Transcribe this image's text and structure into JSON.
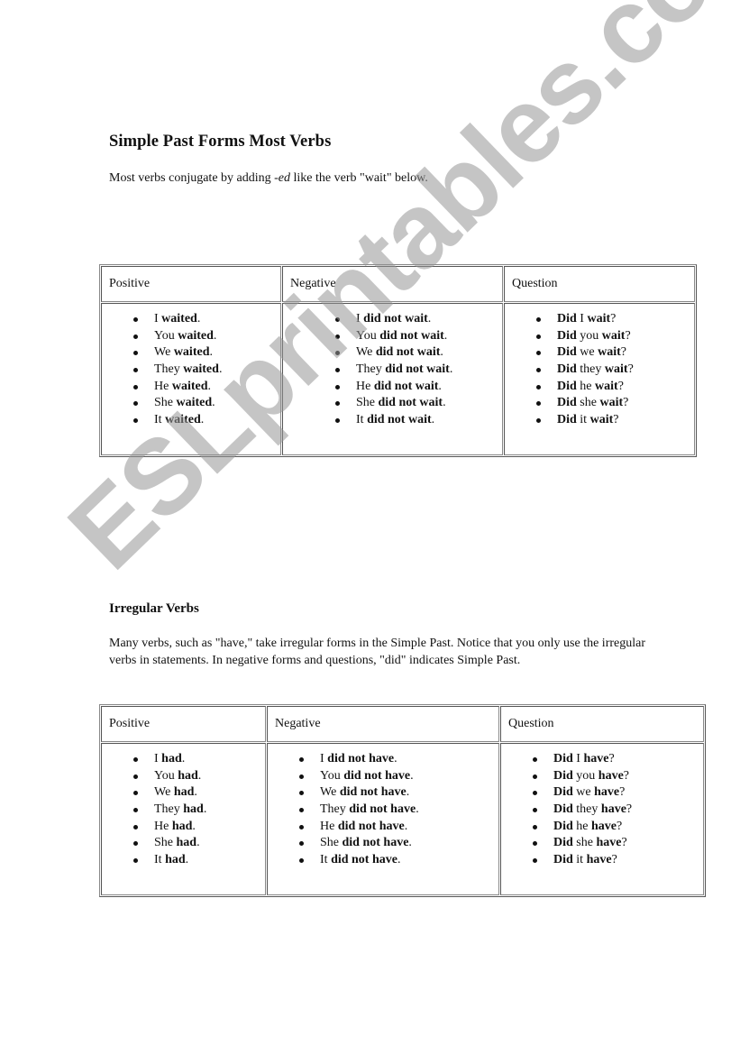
{
  "section1": {
    "title": "Simple Past Forms Most Verbs",
    "intro": {
      "before": "Most verbs conjugate by adding ",
      "italic": "-ed",
      "after": " like the verb \"wait\" below."
    },
    "table": {
      "headers": [
        "Positive",
        "Negative",
        "Question"
      ],
      "columns": [
        [
          [
            {
              "t": "I ",
              "b": false
            },
            {
              "t": "waited",
              "b": true
            },
            {
              "t": ".",
              "b": false
            }
          ],
          [
            {
              "t": "You ",
              "b": false
            },
            {
              "t": "waited",
              "b": true
            },
            {
              "t": ".",
              "b": false
            }
          ],
          [
            {
              "t": "We ",
              "b": false
            },
            {
              "t": "waited",
              "b": true
            },
            {
              "t": ".",
              "b": false
            }
          ],
          [
            {
              "t": "They ",
              "b": false
            },
            {
              "t": "waited",
              "b": true
            },
            {
              "t": ".",
              "b": false
            }
          ],
          [
            {
              "t": "He ",
              "b": false
            },
            {
              "t": "waited",
              "b": true
            },
            {
              "t": ".",
              "b": false
            }
          ],
          [
            {
              "t": "She ",
              "b": false
            },
            {
              "t": "waited",
              "b": true
            },
            {
              "t": ".",
              "b": false
            }
          ],
          [
            {
              "t": "It ",
              "b": false
            },
            {
              "t": "waited",
              "b": true
            },
            {
              "t": ".",
              "b": false
            }
          ]
        ],
        [
          [
            {
              "t": "I ",
              "b": false
            },
            {
              "t": "did not wait",
              "b": true
            },
            {
              "t": ".",
              "b": false
            }
          ],
          [
            {
              "t": "You ",
              "b": false
            },
            {
              "t": "did not wait",
              "b": true
            },
            {
              "t": ".",
              "b": false
            }
          ],
          [
            {
              "t": "We ",
              "b": false
            },
            {
              "t": "did not wait",
              "b": true
            },
            {
              "t": ".",
              "b": false
            }
          ],
          [
            {
              "t": "They ",
              "b": false
            },
            {
              "t": "did not wait",
              "b": true
            },
            {
              "t": ".",
              "b": false
            }
          ],
          [
            {
              "t": "He ",
              "b": false
            },
            {
              "t": "did not wait",
              "b": true
            },
            {
              "t": ".",
              "b": false
            }
          ],
          [
            {
              "t": "She ",
              "b": false
            },
            {
              "t": "did not wait",
              "b": true
            },
            {
              "t": ".",
              "b": false
            }
          ],
          [
            {
              "t": "It ",
              "b": false
            },
            {
              "t": "did not wait",
              "b": true
            },
            {
              "t": ".",
              "b": false
            }
          ]
        ],
        [
          [
            {
              "t": "Did ",
              "b": true
            },
            {
              "t": "I ",
              "b": false
            },
            {
              "t": "wait",
              "b": true
            },
            {
              "t": "?",
              "b": false
            }
          ],
          [
            {
              "t": "Did ",
              "b": true
            },
            {
              "t": "you ",
              "b": false
            },
            {
              "t": "wait",
              "b": true
            },
            {
              "t": "?",
              "b": false
            }
          ],
          [
            {
              "t": "Did ",
              "b": true
            },
            {
              "t": "we ",
              "b": false
            },
            {
              "t": "wait",
              "b": true
            },
            {
              "t": "?",
              "b": false
            }
          ],
          [
            {
              "t": "Did ",
              "b": true
            },
            {
              "t": "they ",
              "b": false
            },
            {
              "t": "wait",
              "b": true
            },
            {
              "t": "?",
              "b": false
            }
          ],
          [
            {
              "t": "Did ",
              "b": true
            },
            {
              "t": "he ",
              "b": false
            },
            {
              "t": "wait",
              "b": true
            },
            {
              "t": "?",
              "b": false
            }
          ],
          [
            {
              "t": "Did ",
              "b": true
            },
            {
              "t": "she ",
              "b": false
            },
            {
              "t": "wait",
              "b": true
            },
            {
              "t": "?",
              "b": false
            }
          ],
          [
            {
              "t": "Did ",
              "b": true
            },
            {
              "t": "it ",
              "b": false
            },
            {
              "t": "wait",
              "b": true
            },
            {
              "t": "?",
              "b": false
            }
          ]
        ]
      ]
    }
  },
  "section2": {
    "title": "Irregular Verbs",
    "intro": "Many verbs, such as \"have,\" take irregular forms in the Simple Past. Notice that you only use the irregular verbs in statements. In negative forms and questions, \"did\" indicates Simple Past.",
    "table": {
      "headers": [
        "Positive",
        "Negative",
        "Question"
      ],
      "columns": [
        [
          [
            {
              "t": "I ",
              "b": false
            },
            {
              "t": "had",
              "b": true
            },
            {
              "t": ".",
              "b": false
            }
          ],
          [
            {
              "t": "You ",
              "b": false
            },
            {
              "t": "had",
              "b": true
            },
            {
              "t": ".",
              "b": false
            }
          ],
          [
            {
              "t": "We ",
              "b": false
            },
            {
              "t": "had",
              "b": true
            },
            {
              "t": ".",
              "b": false
            }
          ],
          [
            {
              "t": "They ",
              "b": false
            },
            {
              "t": "had",
              "b": true
            },
            {
              "t": ".",
              "b": false
            }
          ],
          [
            {
              "t": "He ",
              "b": false
            },
            {
              "t": "had",
              "b": true
            },
            {
              "t": ".",
              "b": false
            }
          ],
          [
            {
              "t": "She ",
              "b": false
            },
            {
              "t": "had",
              "b": true
            },
            {
              "t": ".",
              "b": false
            }
          ],
          [
            {
              "t": "It ",
              "b": false
            },
            {
              "t": "had",
              "b": true
            },
            {
              "t": ".",
              "b": false
            }
          ]
        ],
        [
          [
            {
              "t": "I ",
              "b": false
            },
            {
              "t": "did not have",
              "b": true
            },
            {
              "t": ".",
              "b": false
            }
          ],
          [
            {
              "t": "You ",
              "b": false
            },
            {
              "t": "did not have",
              "b": true
            },
            {
              "t": ".",
              "b": false
            }
          ],
          [
            {
              "t": "We ",
              "b": false
            },
            {
              "t": "did not have",
              "b": true
            },
            {
              "t": ".",
              "b": false
            }
          ],
          [
            {
              "t": "They ",
              "b": false
            },
            {
              "t": "did not have",
              "b": true
            },
            {
              "t": ".",
              "b": false
            }
          ],
          [
            {
              "t": "He ",
              "b": false
            },
            {
              "t": "did not have",
              "b": true
            },
            {
              "t": ".",
              "b": false
            }
          ],
          [
            {
              "t": "She ",
              "b": false
            },
            {
              "t": "did not have",
              "b": true
            },
            {
              "t": ".",
              "b": false
            }
          ],
          [
            {
              "t": "It ",
              "b": false
            },
            {
              "t": "did not have",
              "b": true
            },
            {
              "t": ".",
              "b": false
            }
          ]
        ],
        [
          [
            {
              "t": "Did ",
              "b": true
            },
            {
              "t": "I ",
              "b": false
            },
            {
              "t": "have",
              "b": true
            },
            {
              "t": "?",
              "b": false
            }
          ],
          [
            {
              "t": "Did ",
              "b": true
            },
            {
              "t": "you ",
              "b": false
            },
            {
              "t": "have",
              "b": true
            },
            {
              "t": "?",
              "b": false
            }
          ],
          [
            {
              "t": "Did ",
              "b": true
            },
            {
              "t": "we ",
              "b": false
            },
            {
              "t": "have",
              "b": true
            },
            {
              "t": "?",
              "b": false
            }
          ],
          [
            {
              "t": "Did ",
              "b": true
            },
            {
              "t": "they ",
              "b": false
            },
            {
              "t": "have",
              "b": true
            },
            {
              "t": "?",
              "b": false
            }
          ],
          [
            {
              "t": "Did ",
              "b": true
            },
            {
              "t": "he ",
              "b": false
            },
            {
              "t": "have",
              "b": true
            },
            {
              "t": "?",
              "b": false
            }
          ],
          [
            {
              "t": "Did ",
              "b": true
            },
            {
              "t": "she ",
              "b": false
            },
            {
              "t": "have",
              "b": true
            },
            {
              "t": "?",
              "b": false
            }
          ],
          [
            {
              "t": "Did ",
              "b": true
            },
            {
              "t": "it ",
              "b": false
            },
            {
              "t": "have",
              "b": true
            },
            {
              "t": "?",
              "b": false
            }
          ]
        ]
      ]
    }
  },
  "watermark": {
    "text": "ESLprintables.com",
    "color": "#a6a6a6"
  }
}
